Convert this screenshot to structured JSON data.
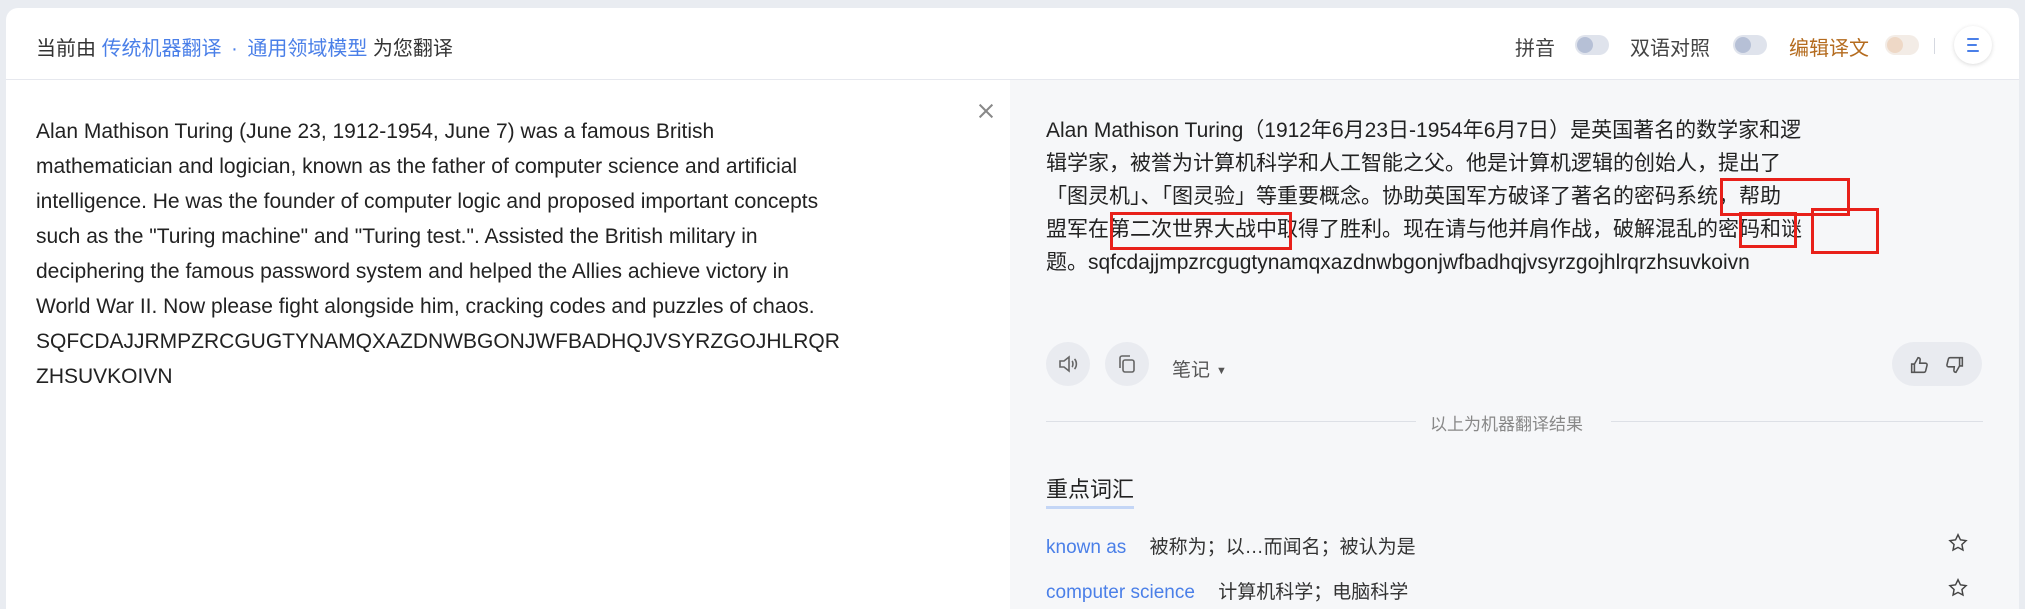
{
  "header": {
    "prefix": "当前由",
    "engine_link": "传统机器翻译",
    "separator": "·",
    "model_link": "通用领域模型",
    "suffix": "为您翻译",
    "pinyin_label": "拼音",
    "bilingual_label": "双语对照",
    "edit_label": "编辑译文"
  },
  "source": {
    "lines": [
      "Alan Mathison Turing (June 23, 1912-1954, June 7) was a famous British",
      "mathematician and logician, known as the father of computer science and artificial",
      "intelligence. He was the founder of computer logic and proposed important concepts",
      "such as the \"Turing machine\" and \"Turing test.\". Assisted the British military in",
      "deciphering the famous password system and helped the Allies achieve victory in",
      "World War II. Now please fight alongside him, cracking codes and puzzles of chaos.",
      "SQFCDAJJRMPZRCGUGTYNAMQXAZDNWBGONJWFBADHQJVSYRZGOJHLRQR",
      "ZHSUVKOIVN"
    ]
  },
  "translation": {
    "lines": [
      "Alan Mathison Turing（1912年6月23日-1954年6月7日）是英国著名的数学家和逻",
      "辑学家，被誉为计算机科学和人工智能之父。他是计算机逻辑的创始人，提出了",
      "「图灵机」、「图灵验」等重要概念。协助英国军方破译了著名的密码系统，帮助",
      "盟军在第二次世界大战中取得了胜利。现在请与他并肩作战，破解混乱的密码和谜",
      "题。sqfcdajjmpzrcgugtynamqxazdnwbgonjwfbadhqjvsyrzgojhlrqrzhsuvkoivn"
    ],
    "notes_label": "笔记",
    "result_label": "以上为机器翻译结果"
  },
  "vocab": {
    "title": "重点词汇",
    "items": [
      {
        "term": "known as",
        "def": "被称为；以…而闻名；被认为是"
      },
      {
        "term": "computer science",
        "def": "计算机科学；电脑科学"
      }
    ]
  }
}
